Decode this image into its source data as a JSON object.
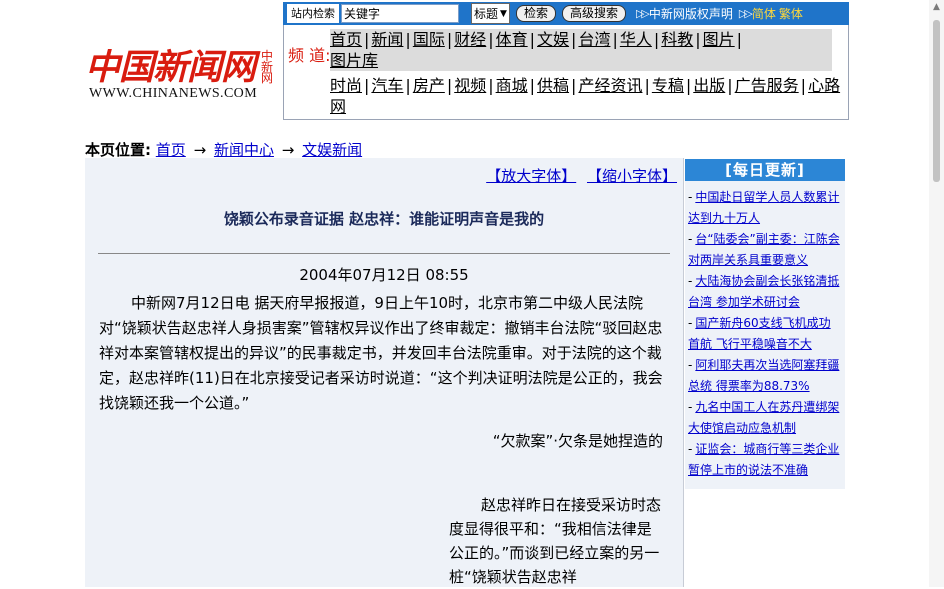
{
  "logo": {
    "name": "中国新闻网",
    "side_text": "中新网",
    "url": "WWW.CHINANEWS.COM"
  },
  "searchbar": {
    "label": "站内检索",
    "input_value": "关键字",
    "select_value": "标题",
    "search_button": "检索",
    "advanced_button": "高级搜索",
    "copyright_link": "中新网版权声明",
    "simplified": "简体",
    "traditional": "繁体"
  },
  "channels": {
    "label": "频 道:",
    "row1": [
      "首页",
      "新闻",
      "国际",
      "财经",
      "体育",
      "文娱",
      "台湾",
      "华人",
      "科教",
      "图片",
      "图片库"
    ],
    "row2": [
      "时尚",
      "汽车",
      "房产",
      "视频",
      "商城",
      "供稿",
      "产经资讯",
      "专稿",
      "出版",
      "广告服务",
      "心路网"
    ]
  },
  "breadcrumb": {
    "label": "本页位置:",
    "items": [
      "首页",
      "新闻中心",
      "文娱新闻"
    ],
    "arrow": "→"
  },
  "article": {
    "font_up": "【放大字体】",
    "font_down": "【缩小字体】",
    "title": "饶颖公布录音证据 赵忠祥：谁能证明声音是我的",
    "date": "2004年07月12日 08:55",
    "paragraph1": "中新网7月12日电 据天府早报报道，9日上午10时，北京市第二中级人民法院对“饶颖状告赵忠祥人身损害案”管辖权异议作出了终审裁定：撤销丰台法院“驳回赵忠祥对本案管辖权提出的异议”的民事裁定书，并发回丰台法院重审。对于法院的这个裁定，赵忠祥昨(11)日在北京接受记者采访时说道：“这个判决证明法院是公正的，我会找饶颖还我一个公道。”",
    "subhead": "“欠款案”·欠条是她捏造的",
    "paragraph2": "赵忠祥昨日在接受采访时态度显得很平和：“我相信法律是公正的。”而谈到已经立案的另一桩“饶颖状告赵忠祥"
  },
  "daily": {
    "header": "[每日更新]",
    "items": [
      "中国赴日留学人员人数累计达到九十万人",
      "台“陆委会”副主委：江陈会对两岸关系具重要意义",
      "大陆海协会副会长张铭清抵台湾 参加学术研讨会",
      "国产新舟60支线飞机成功首航 飞行平稳噪音不大",
      "阿利耶夫再次当选阿塞拜疆总统 得票率为88.73%",
      "九名中国工人在苏丹遭绑架 大使馆启动应急机制",
      "证监会：城商行等三类企业暂停上市的说法不准确"
    ]
  }
}
